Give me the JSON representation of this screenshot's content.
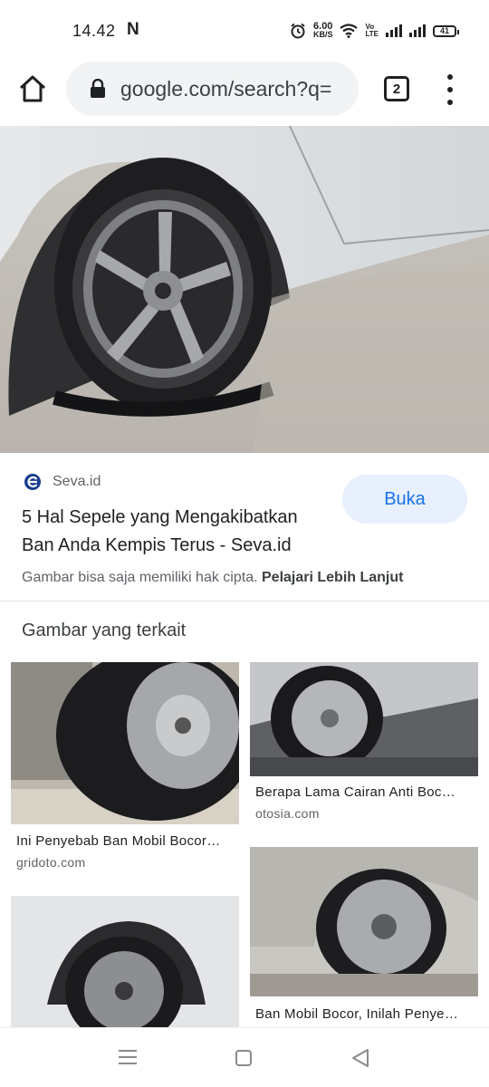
{
  "status_bar": {
    "time": "14.42",
    "notification": "N",
    "speed_value": "6.00",
    "speed_unit": "KB/S",
    "volte_top": "Vo",
    "volte_bottom": "LTE",
    "battery": "41"
  },
  "toolbar": {
    "url": "google.com/search?q=",
    "tab_count": "2"
  },
  "result": {
    "source_name": "Seva.id",
    "title": "5 Hal Sepele yang Mengakibatkan Ban Anda Kempis Terus - Seva.id",
    "open_label": "Buka",
    "copyright_text": "Gambar bisa saja memiliki hak cipta.",
    "learn_more": "Pelajari Lebih Lanjut"
  },
  "related": {
    "heading": "Gambar yang terkait",
    "items": [
      {
        "caption": "Ini Penyebab Ban Mobil Bocor…",
        "domain": "gridoto.com"
      },
      {
        "caption": "Berapa Lama Cairan Anti Boc…",
        "domain": "otosia.com"
      },
      {
        "caption": "Ban Mobil Bocor, Inilah Penye…",
        "domain": ""
      },
      {
        "caption": "",
        "domain": ""
      }
    ]
  },
  "colors": {
    "accent": "#1a73e8",
    "button_bg": "#e8f0fe",
    "muted_text": "#5f6368"
  }
}
